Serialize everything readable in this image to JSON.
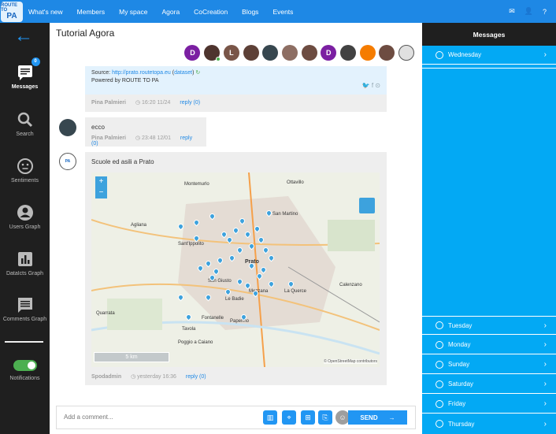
{
  "logo": {
    "top": "ROUTE TO",
    "bottom": "PA"
  },
  "nav": [
    "What's new",
    "Members",
    "My space",
    "Agora",
    "CoCreation",
    "Blogs",
    "Events"
  ],
  "top_icons": [
    "mail-icon",
    "user-icon",
    "help-icon"
  ],
  "sidebar": {
    "items": [
      {
        "label": "Messages",
        "badge": "0",
        "icon": "chat-icon"
      },
      {
        "label": "Search",
        "icon": "search-icon"
      },
      {
        "label": "Sentiments",
        "icon": "smiley-icon"
      },
      {
        "label": "Users Graph",
        "icon": "user-icon"
      },
      {
        "label": "DataIcts Graph",
        "icon": "bar-chart-icon"
      },
      {
        "label": "Comments Graph",
        "icon": "comment-icon"
      },
      {
        "label": "Notifications",
        "icon": "toggle"
      }
    ]
  },
  "main": {
    "title": "Tutorial Agora",
    "avatars": [
      {
        "text": "D",
        "color": "#7b1fa2"
      },
      {
        "text": "",
        "color": "#4e342e"
      },
      {
        "text": "L",
        "color": "#795548"
      },
      {
        "text": "",
        "color": "#5d4037"
      },
      {
        "text": "",
        "color": "#37474f"
      },
      {
        "text": "",
        "color": "#8d6e63"
      },
      {
        "text": "",
        "color": "#6d4c41"
      },
      {
        "text": "D",
        "color": "#7b1fa2"
      },
      {
        "text": "",
        "color": "#424242"
      },
      {
        "text": "",
        "color": "#f57c00"
      },
      {
        "text": "",
        "color": "#6d4c41"
      },
      {
        "text": "",
        "color": "#e0e0e0"
      }
    ],
    "post1": {
      "source_label": "Source:",
      "source_link": "http://prato.routetopa.eu",
      "dataset_link": "dataset",
      "powered": "Powered by ROUTE TO PA",
      "author": "Pina Palmieri",
      "time": "16:20 11/24",
      "reply": "reply (0)"
    },
    "post2": {
      "text": "ecco",
      "author": "Pina Palmieri",
      "time": "23:48 12/01",
      "reply": "reply (0)"
    },
    "post3": {
      "text": "Scuole ed asili a Prato",
      "author": "Spodadmin",
      "time": "yesterday 16:36",
      "reply": "reply (0)",
      "map": {
        "places": [
          "Montemurlo",
          "Agliana",
          "Sant'Ippolito",
          "Prato",
          "Calenzano",
          "San Giusto",
          "Mezzana",
          "Le Badie",
          "Quarrata",
          "Fontanelle",
          "Paperino",
          "Tavola",
          "Poggio a Caiano",
          "La Querce",
          "San Martino",
          "Ottavillo"
        ],
        "scale": "5 km",
        "attribution": "© OpenStreetMap contributors"
      }
    },
    "composer": {
      "placeholder": "Add a comment...",
      "send": "SEND"
    }
  },
  "right_panel": {
    "title": "Messages",
    "days": [
      "Wednesday",
      "Tuesday",
      "Monday",
      "Sunday",
      "Saturday",
      "Friday",
      "Thursday"
    ]
  }
}
